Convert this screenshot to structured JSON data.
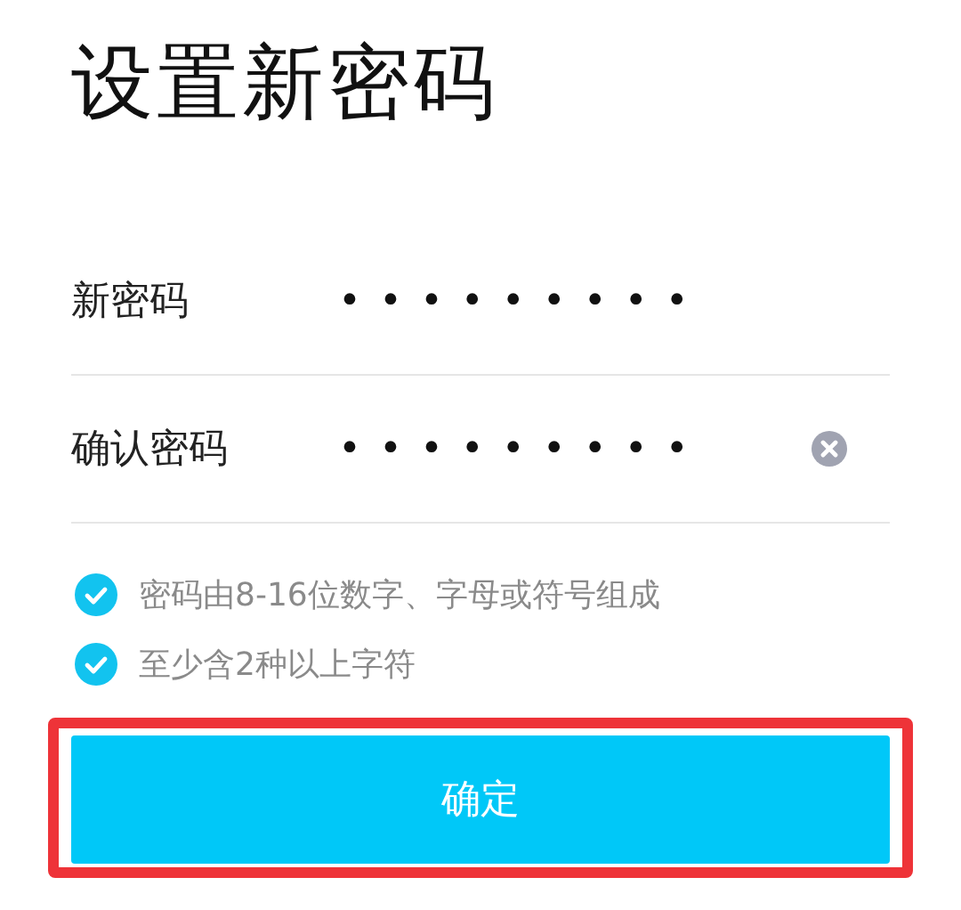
{
  "title": "设置新密码",
  "fields": [
    {
      "label": "新密码",
      "value": "•••••••••",
      "clearable": false
    },
    {
      "label": "确认密码",
      "value": "•••••••••",
      "clearable": true
    }
  ],
  "rules": [
    {
      "text": "密码由8-16位数字、字母或符号组成",
      "checked": true
    },
    {
      "text": "至少含2种以上字符",
      "checked": true
    }
  ],
  "button": {
    "label": "确定",
    "highlighted": true
  }
}
